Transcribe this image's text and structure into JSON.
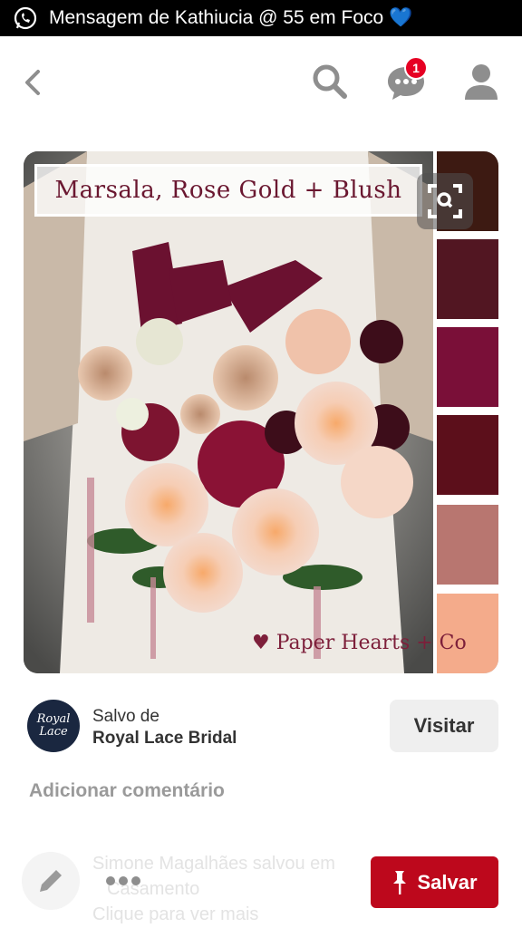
{
  "status_bar": {
    "notification": "Mensagem de Kathiucia @ 55 em Foco 💙",
    "icon": "whatsapp-icon"
  },
  "nav": {
    "back_icon": "back-arrow-icon",
    "search_icon": "search-icon",
    "messages_icon": "chat-bubble-icon",
    "messages_badge": "1",
    "profile_icon": "profile-icon"
  },
  "pin": {
    "title_overlay": "Marsala, Rose Gold + Blush",
    "watermark": "♥ Paper Hearts + Co",
    "lens_icon": "visual-search-icon",
    "palette": [
      "#3d1a12",
      "#521622",
      "#7a0f38",
      "#5c0f1b",
      "#b87670",
      "#f4ab8b"
    ]
  },
  "source": {
    "logo_text": "Royal Lace",
    "saved_from_label": "Salvo de",
    "name": "Royal Lace Bridal",
    "visit_label": "Visitar"
  },
  "comments": {
    "add_label": "Adicionar comentário"
  },
  "footer": {
    "edit_icon": "pencil-icon",
    "more_icon": "more-dots-icon",
    "faded_line_1": "Simone Magalhães salvou em",
    "faded_line_2": "Casamento",
    "faded_line_3": "Clique para ver mais",
    "save_label": "Salvar",
    "save_icon": "pin-icon"
  },
  "colors": {
    "accent": "#bd081c",
    "badge": "#e60023"
  }
}
